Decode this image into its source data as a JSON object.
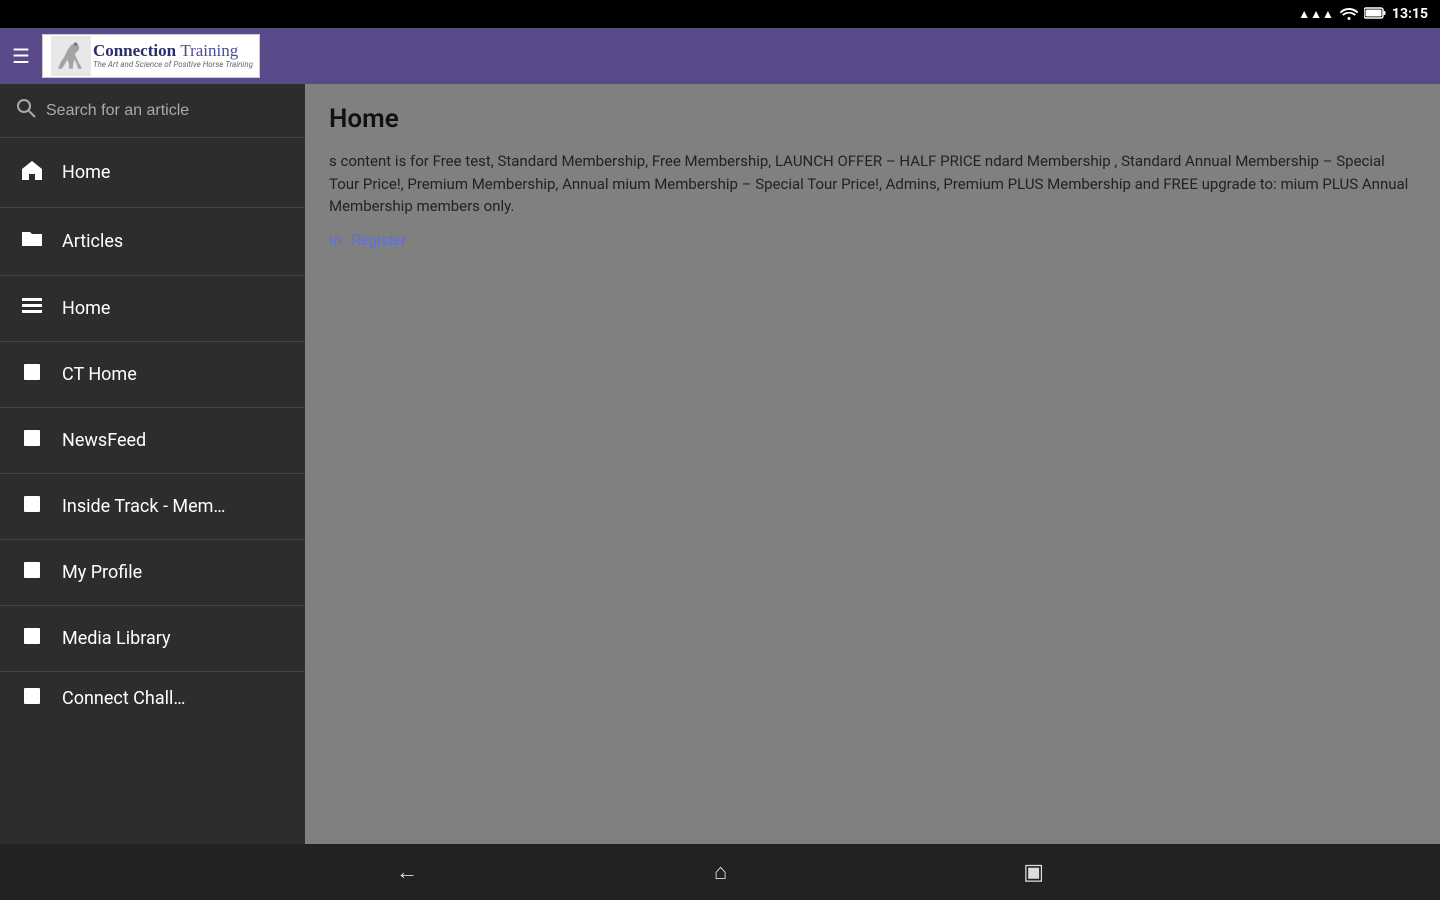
{
  "statusBar": {
    "time": "13:15",
    "wifiIcon": "wifi",
    "batteryIcon": "battery",
    "signalIcon": "signal"
  },
  "header": {
    "menuIcon": "☰",
    "logoAlt": "Connection Training",
    "logoTagline": "The Art and Science of Positive Horse Training"
  },
  "sidebar": {
    "search": {
      "placeholder": "Search for an article",
      "icon": "🔍"
    },
    "navItems": [
      {
        "id": "home",
        "label": "Home",
        "icon": "home"
      },
      {
        "id": "articles",
        "label": "Articles",
        "icon": "folder"
      },
      {
        "id": "home2",
        "label": "Home",
        "icon": "list"
      },
      {
        "id": "ct-home",
        "label": "CT Home",
        "icon": "square"
      },
      {
        "id": "newsfeed",
        "label": "NewsFeed",
        "icon": "square"
      },
      {
        "id": "inside-track",
        "label": "Inside Track - Mem…",
        "icon": "square"
      },
      {
        "id": "my-profile",
        "label": "My Profile",
        "icon": "square"
      },
      {
        "id": "media-library",
        "label": "Media Library",
        "icon": "square"
      },
      {
        "id": "connect-chall",
        "label": "Connect Chall…",
        "icon": "square"
      }
    ]
  },
  "content": {
    "title": "Home",
    "body": "s content is for Free test, Standard Membership, Free Membership, LAUNCH OFFER – HALF PRICE\nndard Membership , Standard Annual Membership – Special Tour Price!, Premium Membership, Annual\nmium Membership – Special Tour Price!, Admins, Premium PLUS Membership and FREE upgrade to:\nmium PLUS Annual Membership members only.",
    "loginLink": "In",
    "registerLink": "Register"
  },
  "bottomBar": {
    "backIcon": "←",
    "homeIcon": "⌂",
    "recentIcon": "▣"
  }
}
